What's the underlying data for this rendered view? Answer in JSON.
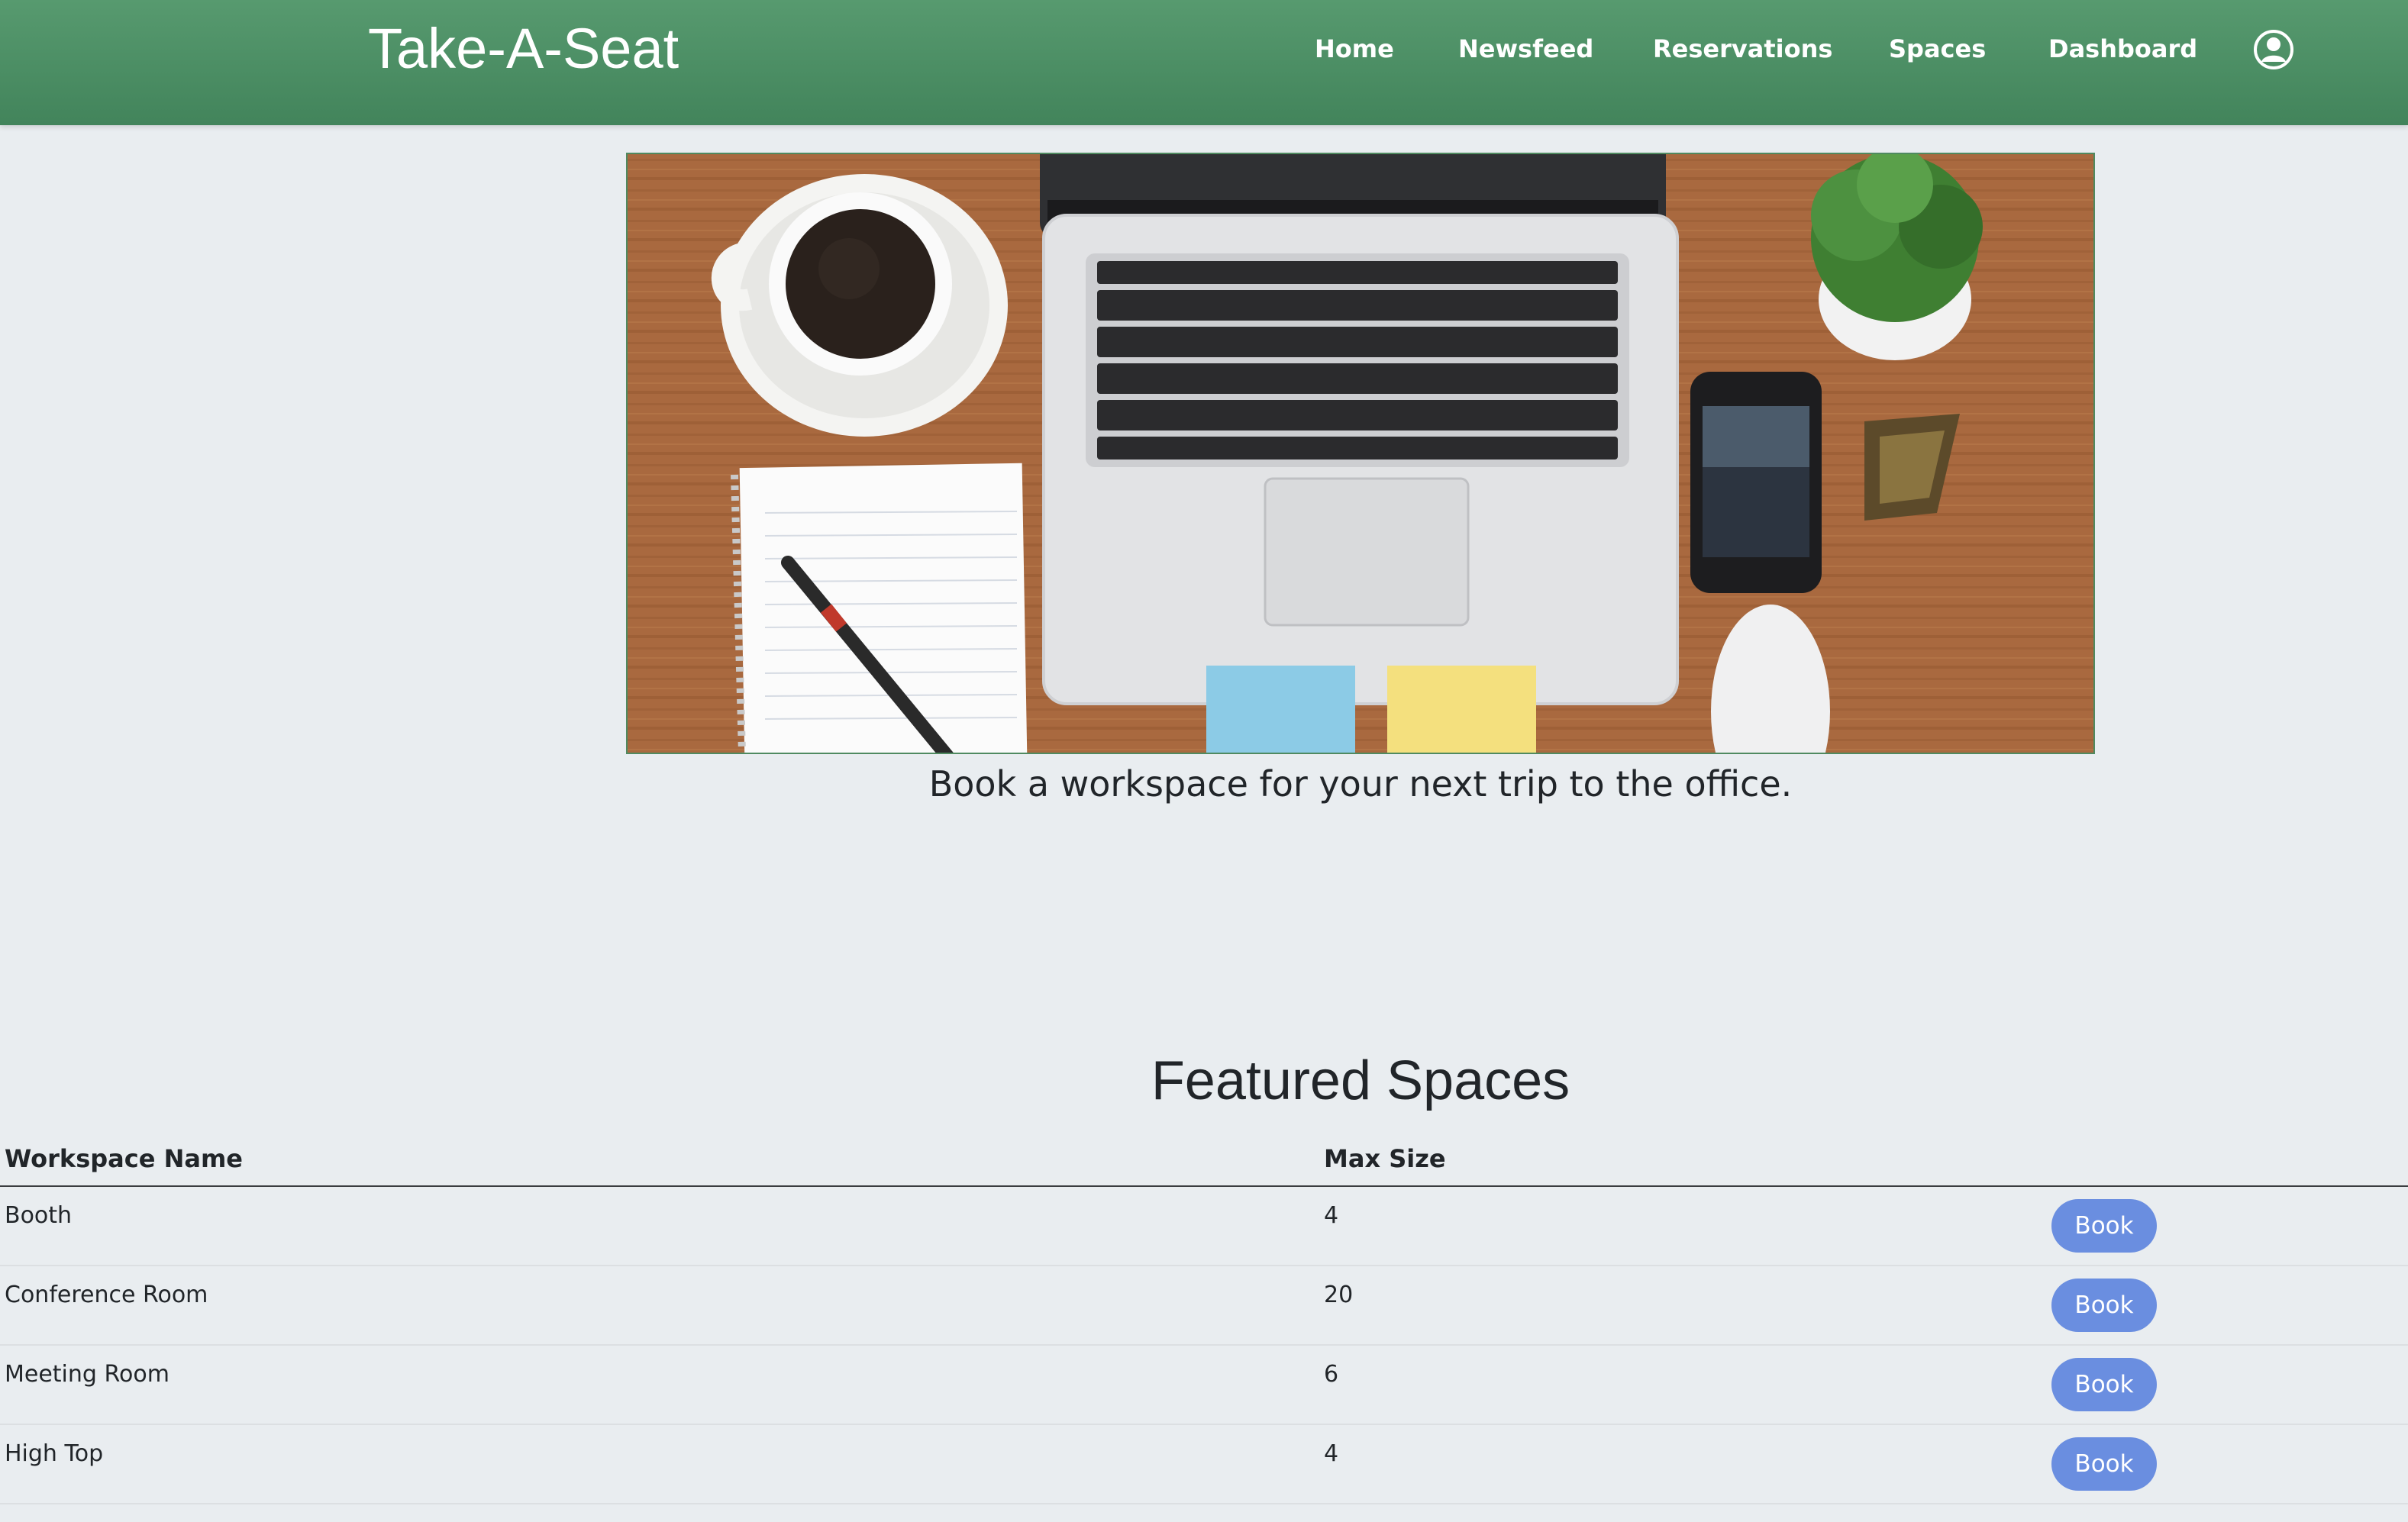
{
  "header": {
    "brand": "Take-A-Seat",
    "nav": [
      "Home",
      "Newsfeed",
      "Reservations",
      "Spaces",
      "Dashboard"
    ],
    "profile_icon": "user-circle-icon"
  },
  "hero": {
    "image": "desk-workspace-photo",
    "tagline": "Book a workspace for your next trip to the office."
  },
  "featured": {
    "title": "Featured Spaces",
    "columns": [
      "Workspace Name",
      "Max Size"
    ],
    "rows": [
      {
        "name": "Booth",
        "max_size": "4",
        "action": "Book"
      },
      {
        "name": "Conference Room",
        "max_size": "20",
        "action": "Book"
      },
      {
        "name": "Meeting Room",
        "max_size": "6",
        "action": "Book"
      },
      {
        "name": "High Top",
        "max_size": "4",
        "action": "Book"
      }
    ]
  },
  "colors": {
    "navbar": "#4a8c62",
    "page_background": "#e9edf0",
    "book_button": "#6a8ee0"
  }
}
